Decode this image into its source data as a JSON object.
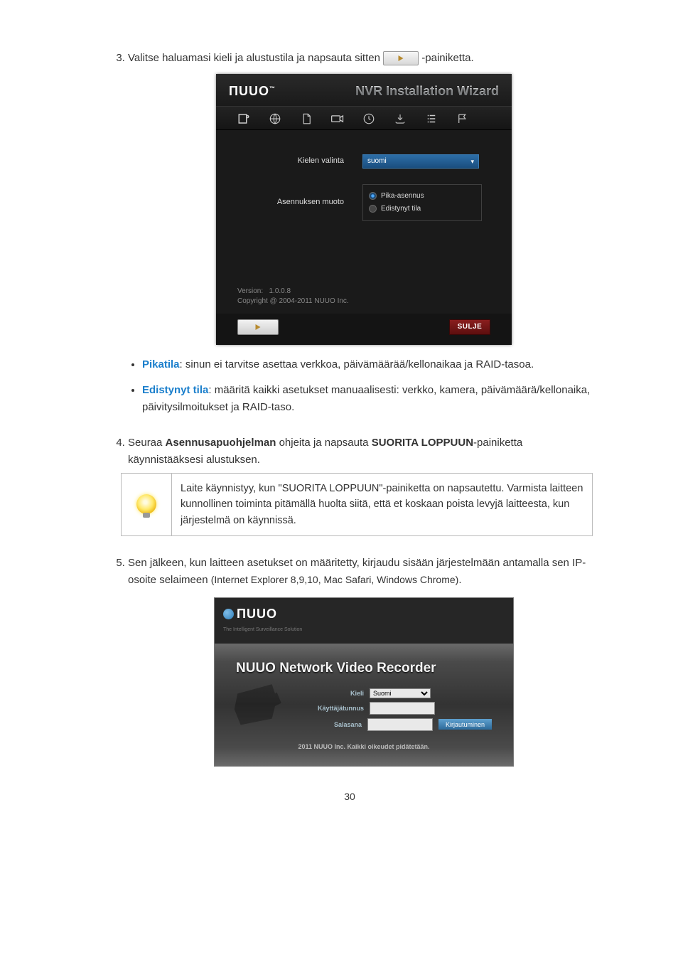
{
  "step3": {
    "text_a": "Valitse haluamasi kieli ja alustustila ja napsauta sitten ",
    "text_b": " -painiketta."
  },
  "wizard": {
    "logo": "ΠUUO",
    "title": "NVR Installation Wizard",
    "label_lang": "Kielen valinta",
    "select_lang": "suomi",
    "label_mode": "Asennuksen muoto",
    "radio_quick": "Pika-asennus",
    "radio_adv": "Edistynyt tila",
    "version_label": "Version:",
    "version_value": "1.0.0.8",
    "copyright": "Copyright @ 2004-2011 NUUO Inc.",
    "close": "SULJE"
  },
  "bullets": {
    "quick_name": "Pikatila",
    "quick_text": ": sinun ei tarvitse asettaa verkkoa, päivämäärää/kellonaikaa ja RAID-tasoa.",
    "adv_name": "Edistynyt tila",
    "adv_text": ": määritä kaikki asetukset manuaalisesti: verkko, kamera, päivämäärä/kellonaika, päivitysilmoitukset ja RAID-taso."
  },
  "step4": {
    "a": "Seuraa ",
    "b": "Asennusapuohjelman",
    "c": " ohjeita ja napsauta ",
    "d": "SUORITA LOPPUUN",
    "e": "-painiketta käynnistääksesi alustuksen."
  },
  "note": "Laite käynnistyy, kun \"SUORITA LOPPUUN\"-painiketta on napsautettu. Varmista laitteen kunnollinen toiminta pitämällä huolta siitä, että et koskaan poista levyjä laitteesta, kun järjestelmä on käynnissä.",
  "step5": {
    "a": "Sen jälkeen, kun laitteen asetukset on määritetty, kirjaudu sisään järjestelmään antamalla sen IP-osoite selaimeen ",
    "b": "(Internet Explorer 8,9,10, Mac Safari, Windows Chrome)",
    "c": "."
  },
  "login": {
    "logo": "ΠUUO",
    "tagline": "The Intelligent Surveillance Solution",
    "title": "NUUO Network Video Recorder",
    "lang_label": "Kieli",
    "lang_value": "Suomi",
    "user_label": "Käyttäjätunnus",
    "pass_label": "Salasana",
    "login_btn": "Kirjautuminen",
    "footer": "2011 NUUO Inc. Kaikki oikeudet pidätetään."
  },
  "page_number": "30"
}
